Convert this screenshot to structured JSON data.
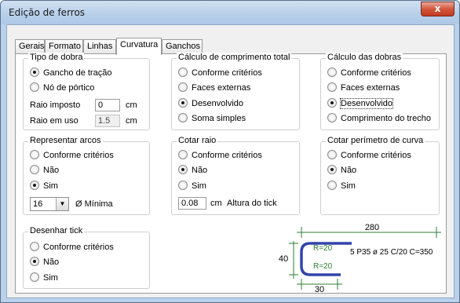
{
  "window": {
    "title": "Edição de ferros",
    "close_label": "x"
  },
  "tabs": [
    {
      "label": "Gerais",
      "active": false
    },
    {
      "label": "Formato",
      "active": false
    },
    {
      "label": "Linhas",
      "active": false
    },
    {
      "label": "Curvatura",
      "active": true
    },
    {
      "label": "Ganchos",
      "active": false
    }
  ],
  "tipo_dobra": {
    "title": "Tipo de dobra",
    "options": [
      {
        "label": "Gancho de tração",
        "selected": true
      },
      {
        "label": "Nó de pórtico",
        "selected": false
      }
    ],
    "raio_imposto_label": "Raio imposto",
    "raio_imposto_value": "0",
    "raio_imposto_unit": "cm",
    "raio_uso_label": "Raio em uso",
    "raio_uso_value": "1.5",
    "raio_uso_unit": "cm"
  },
  "calc_comprimento": {
    "title": "Cálculo de comprimento total",
    "options": [
      {
        "label": "Conforme critérios",
        "selected": false
      },
      {
        "label": "Faces externas",
        "selected": false
      },
      {
        "label": "Desenvolvido",
        "selected": true
      },
      {
        "label": "Soma simples",
        "selected": false
      }
    ]
  },
  "calc_dobras": {
    "title": "Cálculo das dobras",
    "options": [
      {
        "label": "Conforme critérios",
        "selected": false
      },
      {
        "label": "Faces externas",
        "selected": false
      },
      {
        "label": "Desenvolvido",
        "selected": true
      },
      {
        "label": "Comprimento do trecho",
        "selected": false
      }
    ]
  },
  "representar_arcos": {
    "title": "Representar arcos",
    "options": [
      {
        "label": "Conforme critérios",
        "selected": false
      },
      {
        "label": "Não",
        "selected": false
      },
      {
        "label": "Sim",
        "selected": true
      }
    ],
    "select_value": "16",
    "select_label": "Ø Mínima"
  },
  "cotar_raio": {
    "title": "Cotar raio",
    "options": [
      {
        "label": "Conforme critérios",
        "selected": false
      },
      {
        "label": "Não",
        "selected": true
      },
      {
        "label": "Sim",
        "selected": false
      }
    ],
    "tick_value": "0.08",
    "tick_unit": "cm",
    "tick_label": "Altura do tick"
  },
  "cotar_perimetro": {
    "title": "Cotar perímetro de curva",
    "options": [
      {
        "label": "Conforme critérios",
        "selected": false
      },
      {
        "label": "Não",
        "selected": true
      },
      {
        "label": "Sim",
        "selected": false
      }
    ]
  },
  "desenhar_tick": {
    "title": "Desenhar tick",
    "options": [
      {
        "label": "Conforme critérios",
        "selected": false
      },
      {
        "label": "Não",
        "selected": true
      },
      {
        "label": "Sim",
        "selected": false
      }
    ]
  },
  "diagram": {
    "dim_top": "280",
    "dim_left": "40",
    "dim_bottom": "30",
    "radius_top": "R=20",
    "radius_bottom": "R=20",
    "bar_label": "5 P35 ø 25 C/20 C=350",
    "colors": {
      "bar": "#3344aa",
      "dims": "#2e7d32",
      "radius": "#2e7d32",
      "text": "#000000"
    }
  }
}
